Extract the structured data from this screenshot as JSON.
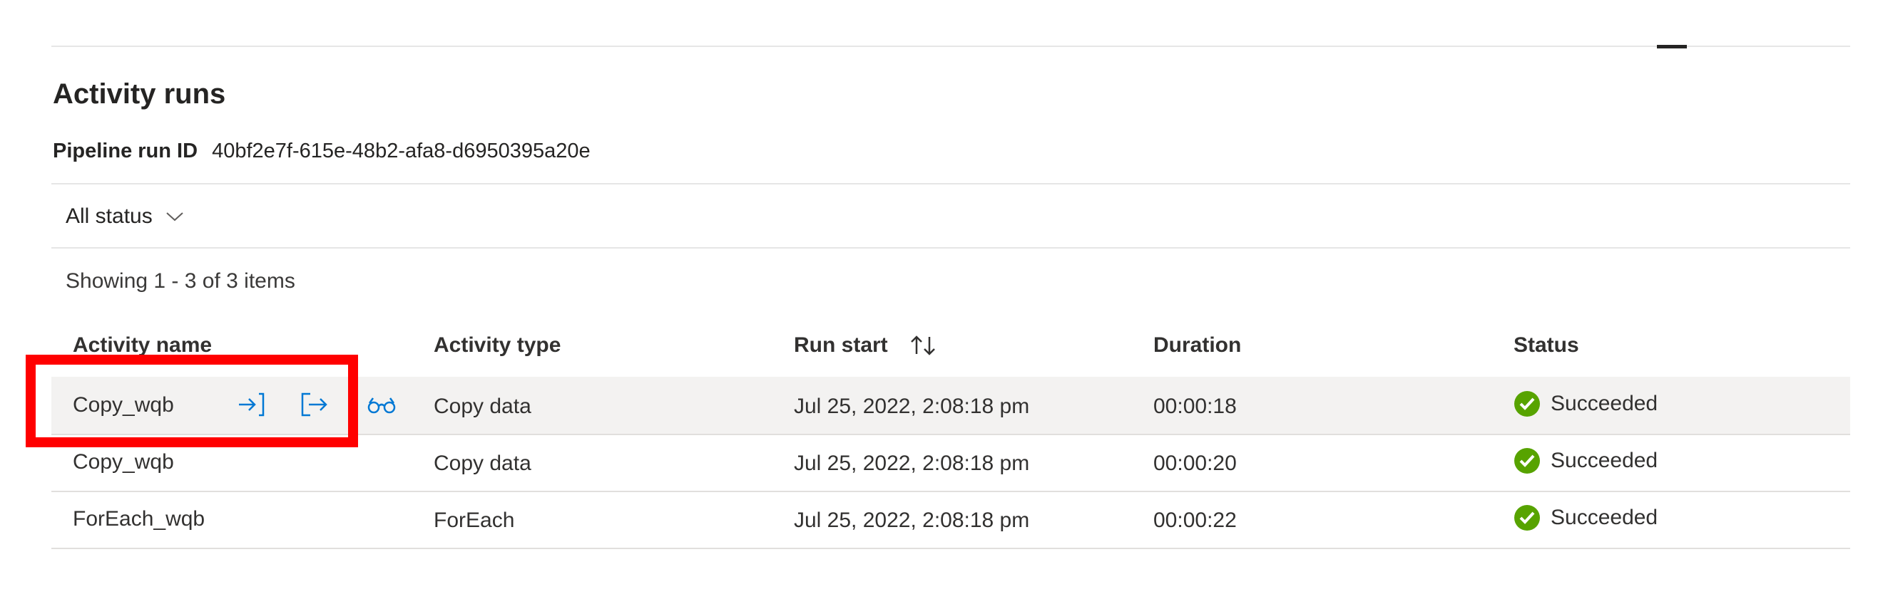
{
  "panel": {
    "title": "Activity runs",
    "pipeline_run_id_label": "Pipeline run ID",
    "pipeline_run_id": "40bf2e7f-615e-48b2-afa8-d6950395a20e"
  },
  "filter": {
    "status_label": "All status"
  },
  "table": {
    "showing": "Showing 1 - 3 of 3 items",
    "columns": [
      "Activity name",
      "Activity type",
      "Run start",
      "Duration",
      "Status"
    ],
    "rows": [
      {
        "name": "Copy_wqb",
        "type": "Copy data",
        "run_start": "Jul 25, 2022, 2:08:18 pm",
        "duration": "00:00:18",
        "status": "Succeeded",
        "selected": true
      },
      {
        "name": "Copy_wqb",
        "type": "Copy data",
        "run_start": "Jul 25, 2022, 2:08:18 pm",
        "duration": "00:00:20",
        "status": "Succeeded",
        "selected": false
      },
      {
        "name": "ForEach_wqb",
        "type": "ForEach",
        "run_start": "Jul 25, 2022, 2:08:18 pm",
        "duration": "00:00:22",
        "status": "Succeeded",
        "selected": false
      }
    ]
  },
  "icons": {
    "input": "input-icon",
    "output": "output-icon",
    "details": "glasses-icon",
    "status_success": "check-circle-icon",
    "sort": "sort-arrows-icon",
    "filter_dropdown": "chevron-down-icon"
  },
  "colors": {
    "accent": "#0078d4",
    "success": "#57a300",
    "highlight": "#ff0000",
    "selected_row": "#f3f2f1"
  }
}
